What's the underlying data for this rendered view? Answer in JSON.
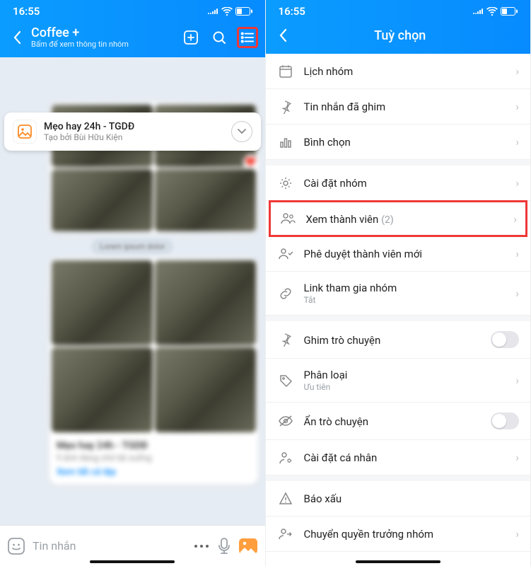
{
  "status": {
    "time": "16:55"
  },
  "left": {
    "header": {
      "title": "Coffee +",
      "subtitle": "Bấm để xem thông tin nhóm"
    },
    "pinned": {
      "title": "Mẹo hay 24h - TGDĐ",
      "subtitle": "Tạo bởi Bùi Hữu Kiện"
    },
    "input": {
      "placeholder": "Tin nhắn"
    }
  },
  "right": {
    "header": {
      "title": "Tuỳ chọn"
    },
    "items": {
      "calendar": {
        "label": "Lịch nhóm"
      },
      "pinnedMsg": {
        "label": "Tin nhắn đã ghim"
      },
      "poll": {
        "label": "Bình chọn"
      },
      "settings": {
        "label": "Cài đặt nhóm"
      },
      "members": {
        "label": "Xem thành viên",
        "count": "(2)"
      },
      "approve": {
        "label": "Phê duyệt thành viên mới"
      },
      "link": {
        "label": "Link tham gia nhóm",
        "sub": "Tắt"
      },
      "pinChat": {
        "label": "Ghim trò chuyện"
      },
      "category": {
        "label": "Phân loại",
        "sub": "Ưu tiên"
      },
      "hide": {
        "label": "Ẩn trò chuyện"
      },
      "personal": {
        "label": "Cài đặt cá nhân"
      },
      "report": {
        "label": "Báo xấu"
      },
      "transfer": {
        "label": "Chuyển quyền trưởng nhóm"
      }
    }
  }
}
